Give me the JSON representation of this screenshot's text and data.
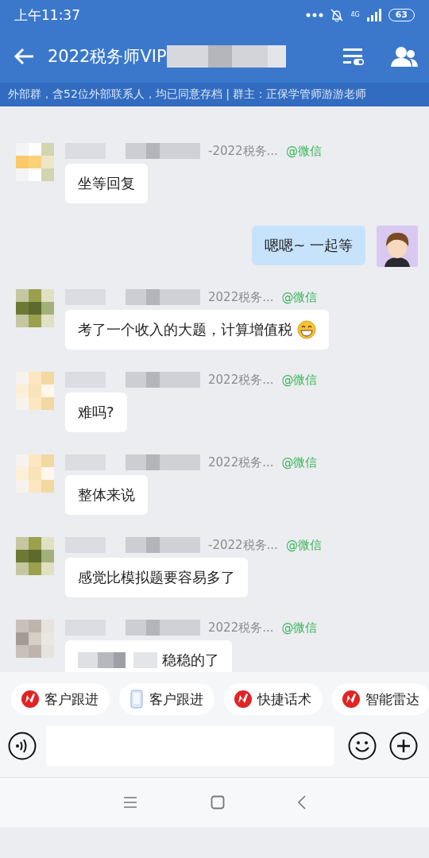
{
  "status_bar": {
    "time": "上午11:37",
    "network": "4G",
    "battery": "63"
  },
  "header": {
    "title": "2022税务师VIP",
    "title_redacted": true
  },
  "banner": {
    "text": "外部群，含52位外部联系人，均已同意存档 | 群主：正保学管师游游老师"
  },
  "messages": [
    {
      "kind": "in",
      "sender": "-2022税务...",
      "source": "@微信",
      "text": "坐等回复",
      "emoji": false,
      "redacted_prefix": false
    },
    {
      "kind": "out",
      "text": "嗯嗯~ 一起等"
    },
    {
      "kind": "in",
      "sender": "2022税务...",
      "source": "@微信",
      "text": "考了一个收入的大题，计算增值税",
      "emoji": true,
      "redacted_prefix": false
    },
    {
      "kind": "in",
      "sender": "2022税务...",
      "source": "@微信",
      "text": "难吗?",
      "emoji": false,
      "redacted_prefix": false
    },
    {
      "kind": "in",
      "sender": "2022税务...",
      "source": "@微信",
      "text": "整体来说",
      "emoji": false,
      "redacted_prefix": false
    },
    {
      "kind": "in",
      "sender": "-2022税务...",
      "source": "@微信",
      "text": "感觉比模拟题要容易多了",
      "emoji": false,
      "redacted_prefix": false
    },
    {
      "kind": "in",
      "sender": "2022税务...",
      "source": "@微信",
      "text": "稳稳的了",
      "emoji": false,
      "redacted_prefix": true
    }
  ],
  "quick_actions": [
    {
      "kind": "brand",
      "label": "客户跟进"
    },
    {
      "kind": "phone",
      "label": "客户跟进"
    },
    {
      "kind": "brand",
      "label": "快捷话术"
    },
    {
      "kind": "brand",
      "label": "智能雷达"
    }
  ]
}
